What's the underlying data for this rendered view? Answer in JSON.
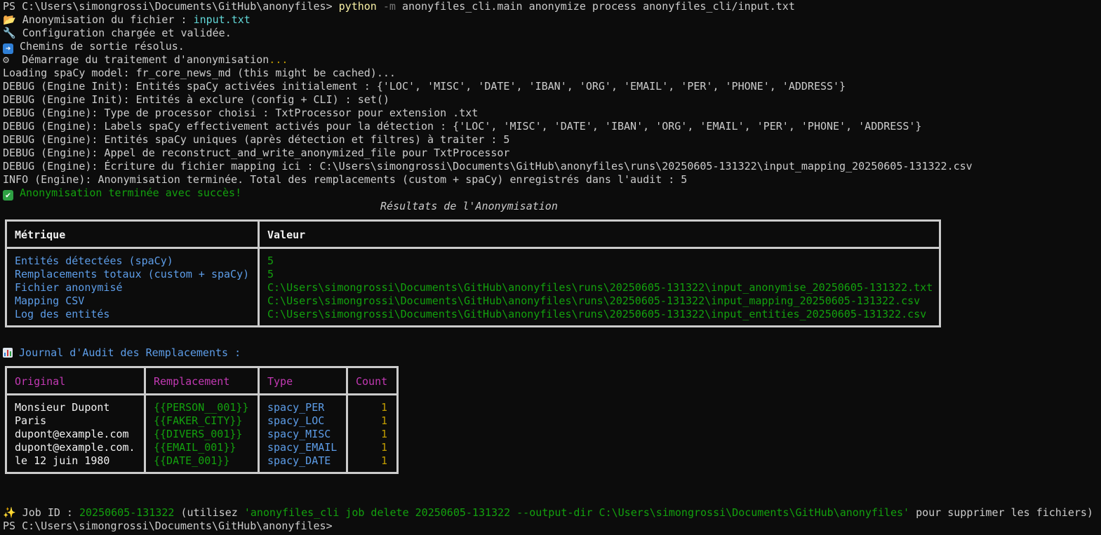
{
  "terminal": {
    "prompt_line": {
      "prompt": "PS C:\\Users\\simongrossi\\Documents\\GitHub\\anonyfiles> ",
      "cmd": "python",
      "flag": "-m",
      "args": " anonyfiles_cli.main anonymize process anonyfiles_cli/input.txt"
    },
    "status": [
      {
        "icon": "folder-icon",
        "glyph": "📂",
        "text": "Anonymisation du fichier : ",
        "value": "input.txt"
      },
      {
        "icon": "wrench-icon",
        "glyph": "🔧",
        "text": "Configuration chargée et validée.",
        "value": ""
      },
      {
        "icon": "arrow-right-icon",
        "glyph": "➡",
        "text": " Chemins de sortie résolus.",
        "value": ""
      },
      {
        "icon": "gear-icon",
        "glyph": "⚙",
        "text": " Démarrage du traitement d'anonymisation",
        "value": "..."
      }
    ],
    "log_lines": [
      "Loading spaCy model: fr_core_news_md (this might be cached)...",
      "DEBUG (Engine Init): Entités spaCy activées initialement : {'LOC', 'MISC', 'DATE', 'IBAN', 'ORG', 'EMAIL', 'PER', 'PHONE', 'ADDRESS'}",
      "DEBUG (Engine Init): Entités à exclure (config + CLI) : set()",
      "DEBUG (Engine): Type de processor choisi : TxtProcessor pour extension .txt",
      "DEBUG (Engine): Labels spaCy effectivement activés pour la détection : {'LOC', 'MISC', 'DATE', 'IBAN', 'ORG', 'EMAIL', 'PER', 'PHONE', 'ADDRESS'}",
      "DEBUG (Engine): Entités spaCy uniques (après détection et filtres) à traiter : 5",
      "DEBUG (Engine): Appel de reconstruct_and_write_anonymized_file pour TxtProcessor",
      "DEBUG (Engine): Écriture du fichier mapping ici : C:\\Users\\simongrossi\\Documents\\GitHub\\anonyfiles\\runs\\20250605-131322\\input_mapping_20250605-131322.csv",
      "INFO (Engine): Anonymisation terminée. Total des remplacements (custom + spaCy) enregistrés dans l'audit : 5"
    ],
    "success": {
      "icon": "check-icon",
      "glyph": "✔",
      "text": "Anonymisation terminée avec succès!"
    },
    "results": {
      "title": "Résultats de l'Anonymisation",
      "headers": [
        "Métrique",
        "Valeur"
      ],
      "rows": [
        [
          "Entités détectées (spaCy)",
          "5"
        ],
        [
          "Remplacements totaux (custom + spaCy)",
          "5"
        ],
        [
          "Fichier anonymisé",
          "C:\\Users\\simongrossi\\Documents\\GitHub\\anonyfiles\\runs\\20250605-131322\\input_anonymise_20250605-131322.txt"
        ],
        [
          "Mapping CSV",
          "C:\\Users\\simongrossi\\Documents\\GitHub\\anonyfiles\\runs\\20250605-131322\\input_mapping_20250605-131322.csv"
        ],
        [
          "Log des entités",
          "C:\\Users\\simongrossi\\Documents\\GitHub\\anonyfiles\\runs\\20250605-131322\\input_entities_20250605-131322.csv"
        ]
      ]
    },
    "audit": {
      "icon": "bar-chart-icon",
      "title": "Journal d'Audit des Remplacements :",
      "headers": [
        "Original",
        "Remplacement",
        "Type",
        "Count"
      ],
      "rows": [
        [
          "Monsieur Dupont",
          "{{PERSON__001}}",
          "spacy_PER",
          "1"
        ],
        [
          "Paris",
          "{{FAKER_CITY}}",
          "spacy_LOC",
          "1"
        ],
        [
          "dupont@example.com",
          "{{DIVERS_001}}",
          "spacy_MISC",
          "1"
        ],
        [
          "dupont@example.com.",
          "{{EMAIL_001}}",
          "spacy_EMAIL",
          "1"
        ],
        [
          "le 12 juin 1980",
          "{{DATE_001}}",
          "spacy_DATE",
          "1"
        ]
      ]
    },
    "job": {
      "icon": "sparkles-icon",
      "glyph": "✨",
      "label": " Job ID : ",
      "id": "20250605-131322",
      "pre": " (utilisez ",
      "cmd": "'anonyfiles_cli job delete 20250605-131322 --output-dir C:\\Users\\simongrossi\\Documents\\GitHub\\anonyfiles'",
      "post": " pour supprimer les fichiers)"
    },
    "final_prompt": "PS C:\\Users\\simongrossi\\Documents\\GitHub\\anonyfiles>"
  }
}
